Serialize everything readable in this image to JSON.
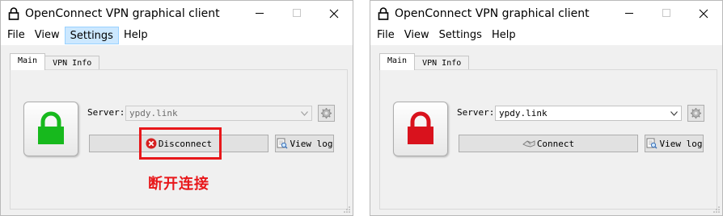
{
  "windows": [
    {
      "title": "OpenConnect VPN graphical client",
      "menu": [
        "File",
        "View",
        "Settings",
        "Help"
      ],
      "active_menu": "Settings",
      "tabs": [
        "Main",
        "VPN Info"
      ],
      "selected_tab": "Main",
      "status": "connected",
      "lock_color": "#17b91d",
      "server_label": "Server:",
      "server_value": "ypdy.link",
      "server_enabled": false,
      "action_button_label": "Disconnect",
      "action_icon": "disconnect-icon",
      "view_log_label": "View log"
    },
    {
      "title": "OpenConnect VPN graphical client",
      "menu": [
        "File",
        "View",
        "Settings",
        "Help"
      ],
      "active_menu": "",
      "tabs": [
        "Main",
        "VPN Info"
      ],
      "selected_tab": "Main",
      "status": "disconnected",
      "lock_color": "#d9121d",
      "server_label": "Server:",
      "server_value": "ypdy.link",
      "server_enabled": true,
      "action_button_label": "Connect",
      "action_icon": "connect-icon",
      "view_log_label": "View log"
    }
  ],
  "annotation": {
    "text": "断开连接",
    "color": "#e8171a"
  }
}
